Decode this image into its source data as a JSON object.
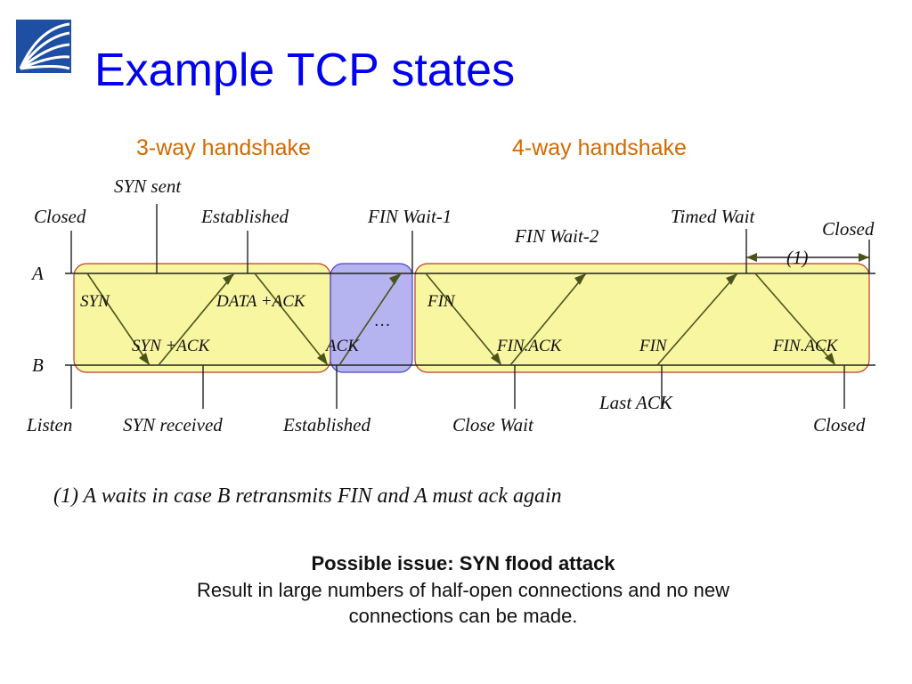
{
  "title": "Example TCP states",
  "subhead_left": "3-way handshake",
  "subhead_right": "4-way handshake",
  "hosts": {
    "A": "A",
    "B": "B"
  },
  "states_A": {
    "closed": "Closed",
    "syn_sent": "SYN sent",
    "established": "Established",
    "fin_wait_1": "FIN Wait-1",
    "fin_wait_2": "FIN Wait-2",
    "timed_wait": "Timed Wait",
    "closed_end": "Closed",
    "note_ref": "(1)"
  },
  "states_B": {
    "listen": "Listen",
    "syn_received": "SYN received",
    "established": "Established",
    "close_wait": "Close Wait",
    "last_ack": "Last ACK",
    "closed": "Closed"
  },
  "messages": {
    "syn": "SYN",
    "syn_ack": "SYN +ACK",
    "data_ack": "DATA +ACK",
    "ack": "ACK",
    "dots": "…",
    "fin1": "FIN",
    "finack1": "FIN.ACK",
    "fin2": "FIN",
    "finack2": "FIN.ACK"
  },
  "footnote": "(1) A waits in case B retransmits FIN and A must ack again",
  "issue": {
    "headline": "Possible issue: SYN flood attack",
    "body_1": "Result in large numbers of half-open connections and no new",
    "body_2": "connections can be made."
  },
  "colors": {
    "title": "#0000ee",
    "subhead": "#d26900",
    "highlight_yellow": "#f4f060",
    "highlight_blue": "#7a74e6",
    "box_stroke": "#c0392b",
    "arrow": "#4a541a",
    "ink": "#222222"
  }
}
